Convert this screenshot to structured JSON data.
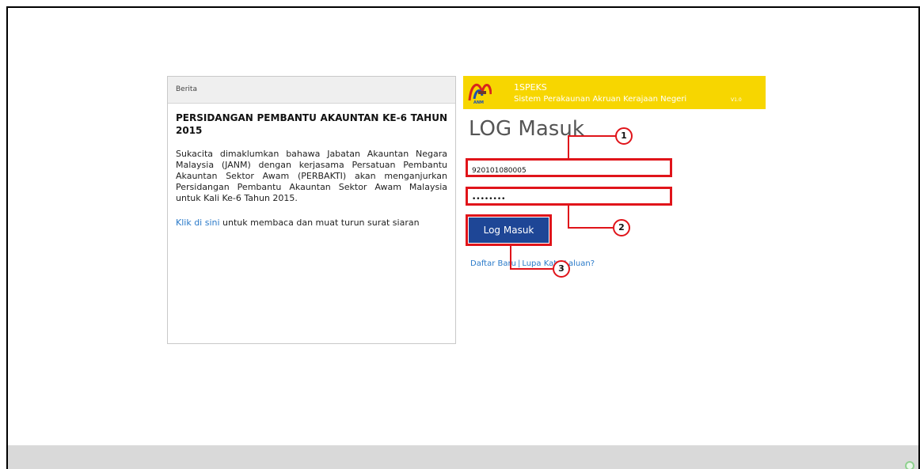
{
  "news": {
    "header": "Berita",
    "title": "PERSIDANGAN PEMBANTU AKAUNTAN KE-6 TAHUN 2015",
    "body": "Sukacita dimaklumkan bahawa Jabatan Akauntan Negara Malaysia (JANM) dengan kerjasama Persatuan Pembantu Akauntan Sektor Awam (PERBAKTI) akan menganjurkan Persidangan Pembantu Akauntan Sektor Awam Malaysia untuk Kali Ke-6 Tahun 2015.",
    "link_text": "Klik di sini",
    "link_suffix": " untuk membaca dan muat turun surat siaran"
  },
  "brand": {
    "logo_text": "ANM",
    "name": "1SPEKS",
    "subtitle": "Sistem Perakaunan Akruan Kerajaan Negeri",
    "version": "V1.0",
    "color": "#f7d600"
  },
  "login": {
    "title": "LOG Masuk",
    "username_value": "920101080005",
    "password_value": "••••••••",
    "button_label": "Log Masuk",
    "register_link": "Daftar Baru",
    "separator": "|",
    "forgot_link": "Lupa Kata Laluan?"
  },
  "callouts": {
    "one": "1",
    "two": "2",
    "three": "3",
    "color": "#e0141a"
  }
}
